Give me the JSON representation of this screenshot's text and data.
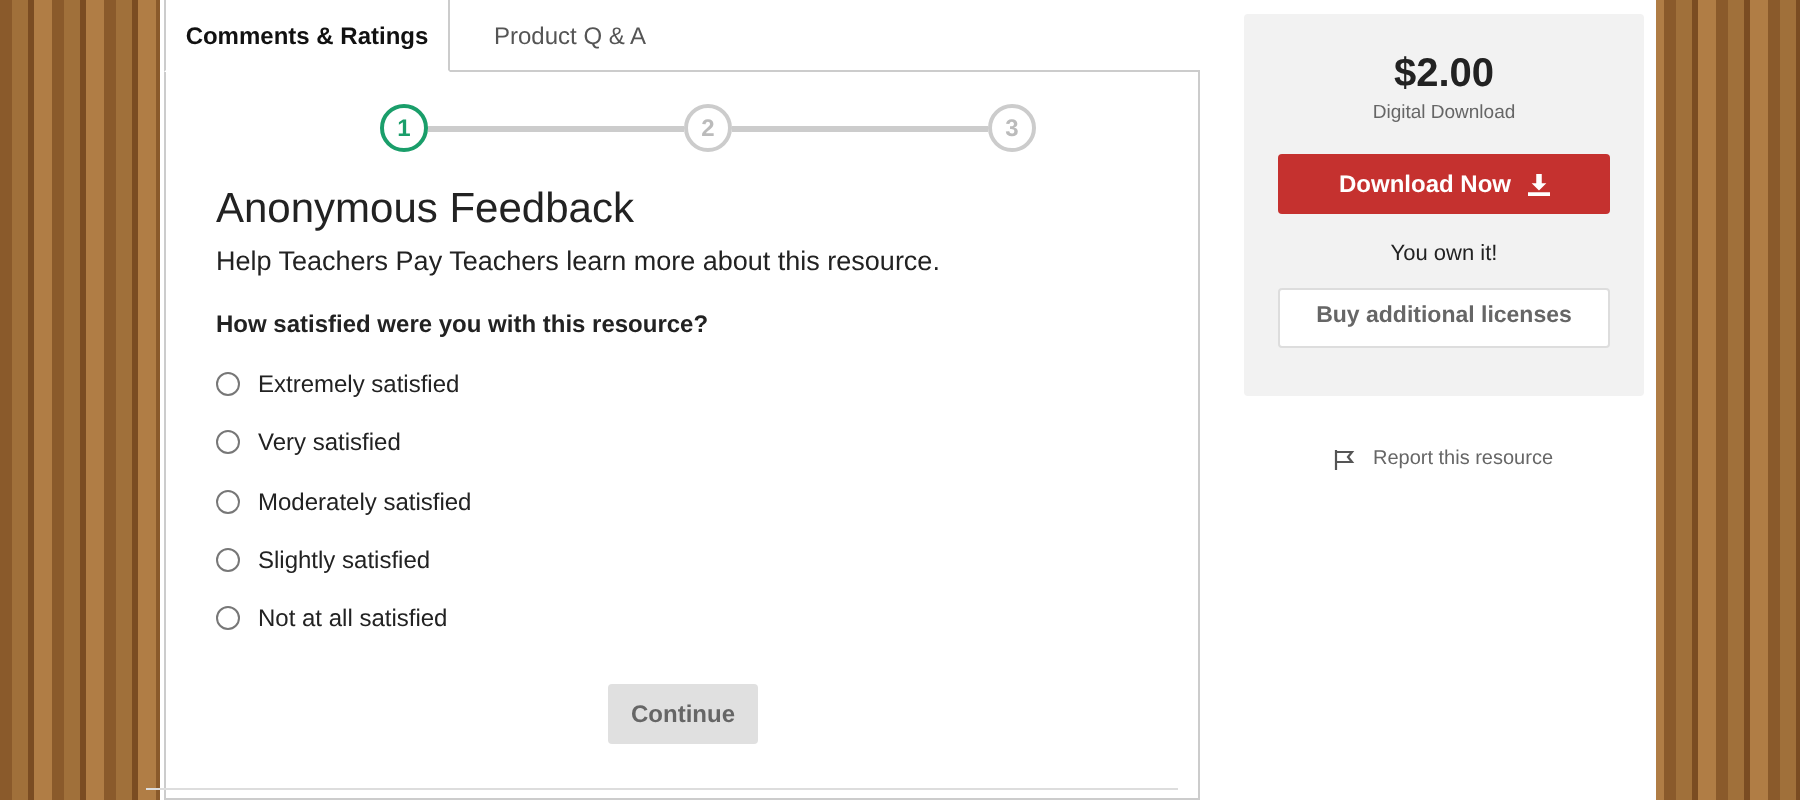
{
  "tabs": [
    {
      "label": "Comments & Ratings",
      "selected": true
    },
    {
      "label": "Product Q & A",
      "selected": false
    }
  ],
  "stepper": [
    {
      "label": "1",
      "current": true
    },
    {
      "label": "2",
      "current": false
    },
    {
      "label": "3",
      "current": false
    }
  ],
  "form": {
    "heading": "Anonymous Feedback",
    "subtitle": "Help Teachers Pay Teachers learn more about this resource.",
    "question": "How satisfied were you with this resource?",
    "options": [
      {
        "label": "Extremely satisfied",
        "selected": false
      },
      {
        "label": "Very satisfied",
        "selected": false
      },
      {
        "label": "Moderately satisfied",
        "selected": false
      },
      {
        "label": "Slightly satisfied",
        "selected": false
      },
      {
        "label": "Not at all satisfied",
        "selected": false
      }
    ],
    "continue_button": {
      "label": "Continue",
      "disabled": true
    }
  },
  "purchase": {
    "price": "$2.00",
    "format": "Digital Download",
    "download_button": "Download Now",
    "owned_note": "You own it!",
    "licenses_button": "Buy additional licenses"
  },
  "report_link": "Report this resource"
}
